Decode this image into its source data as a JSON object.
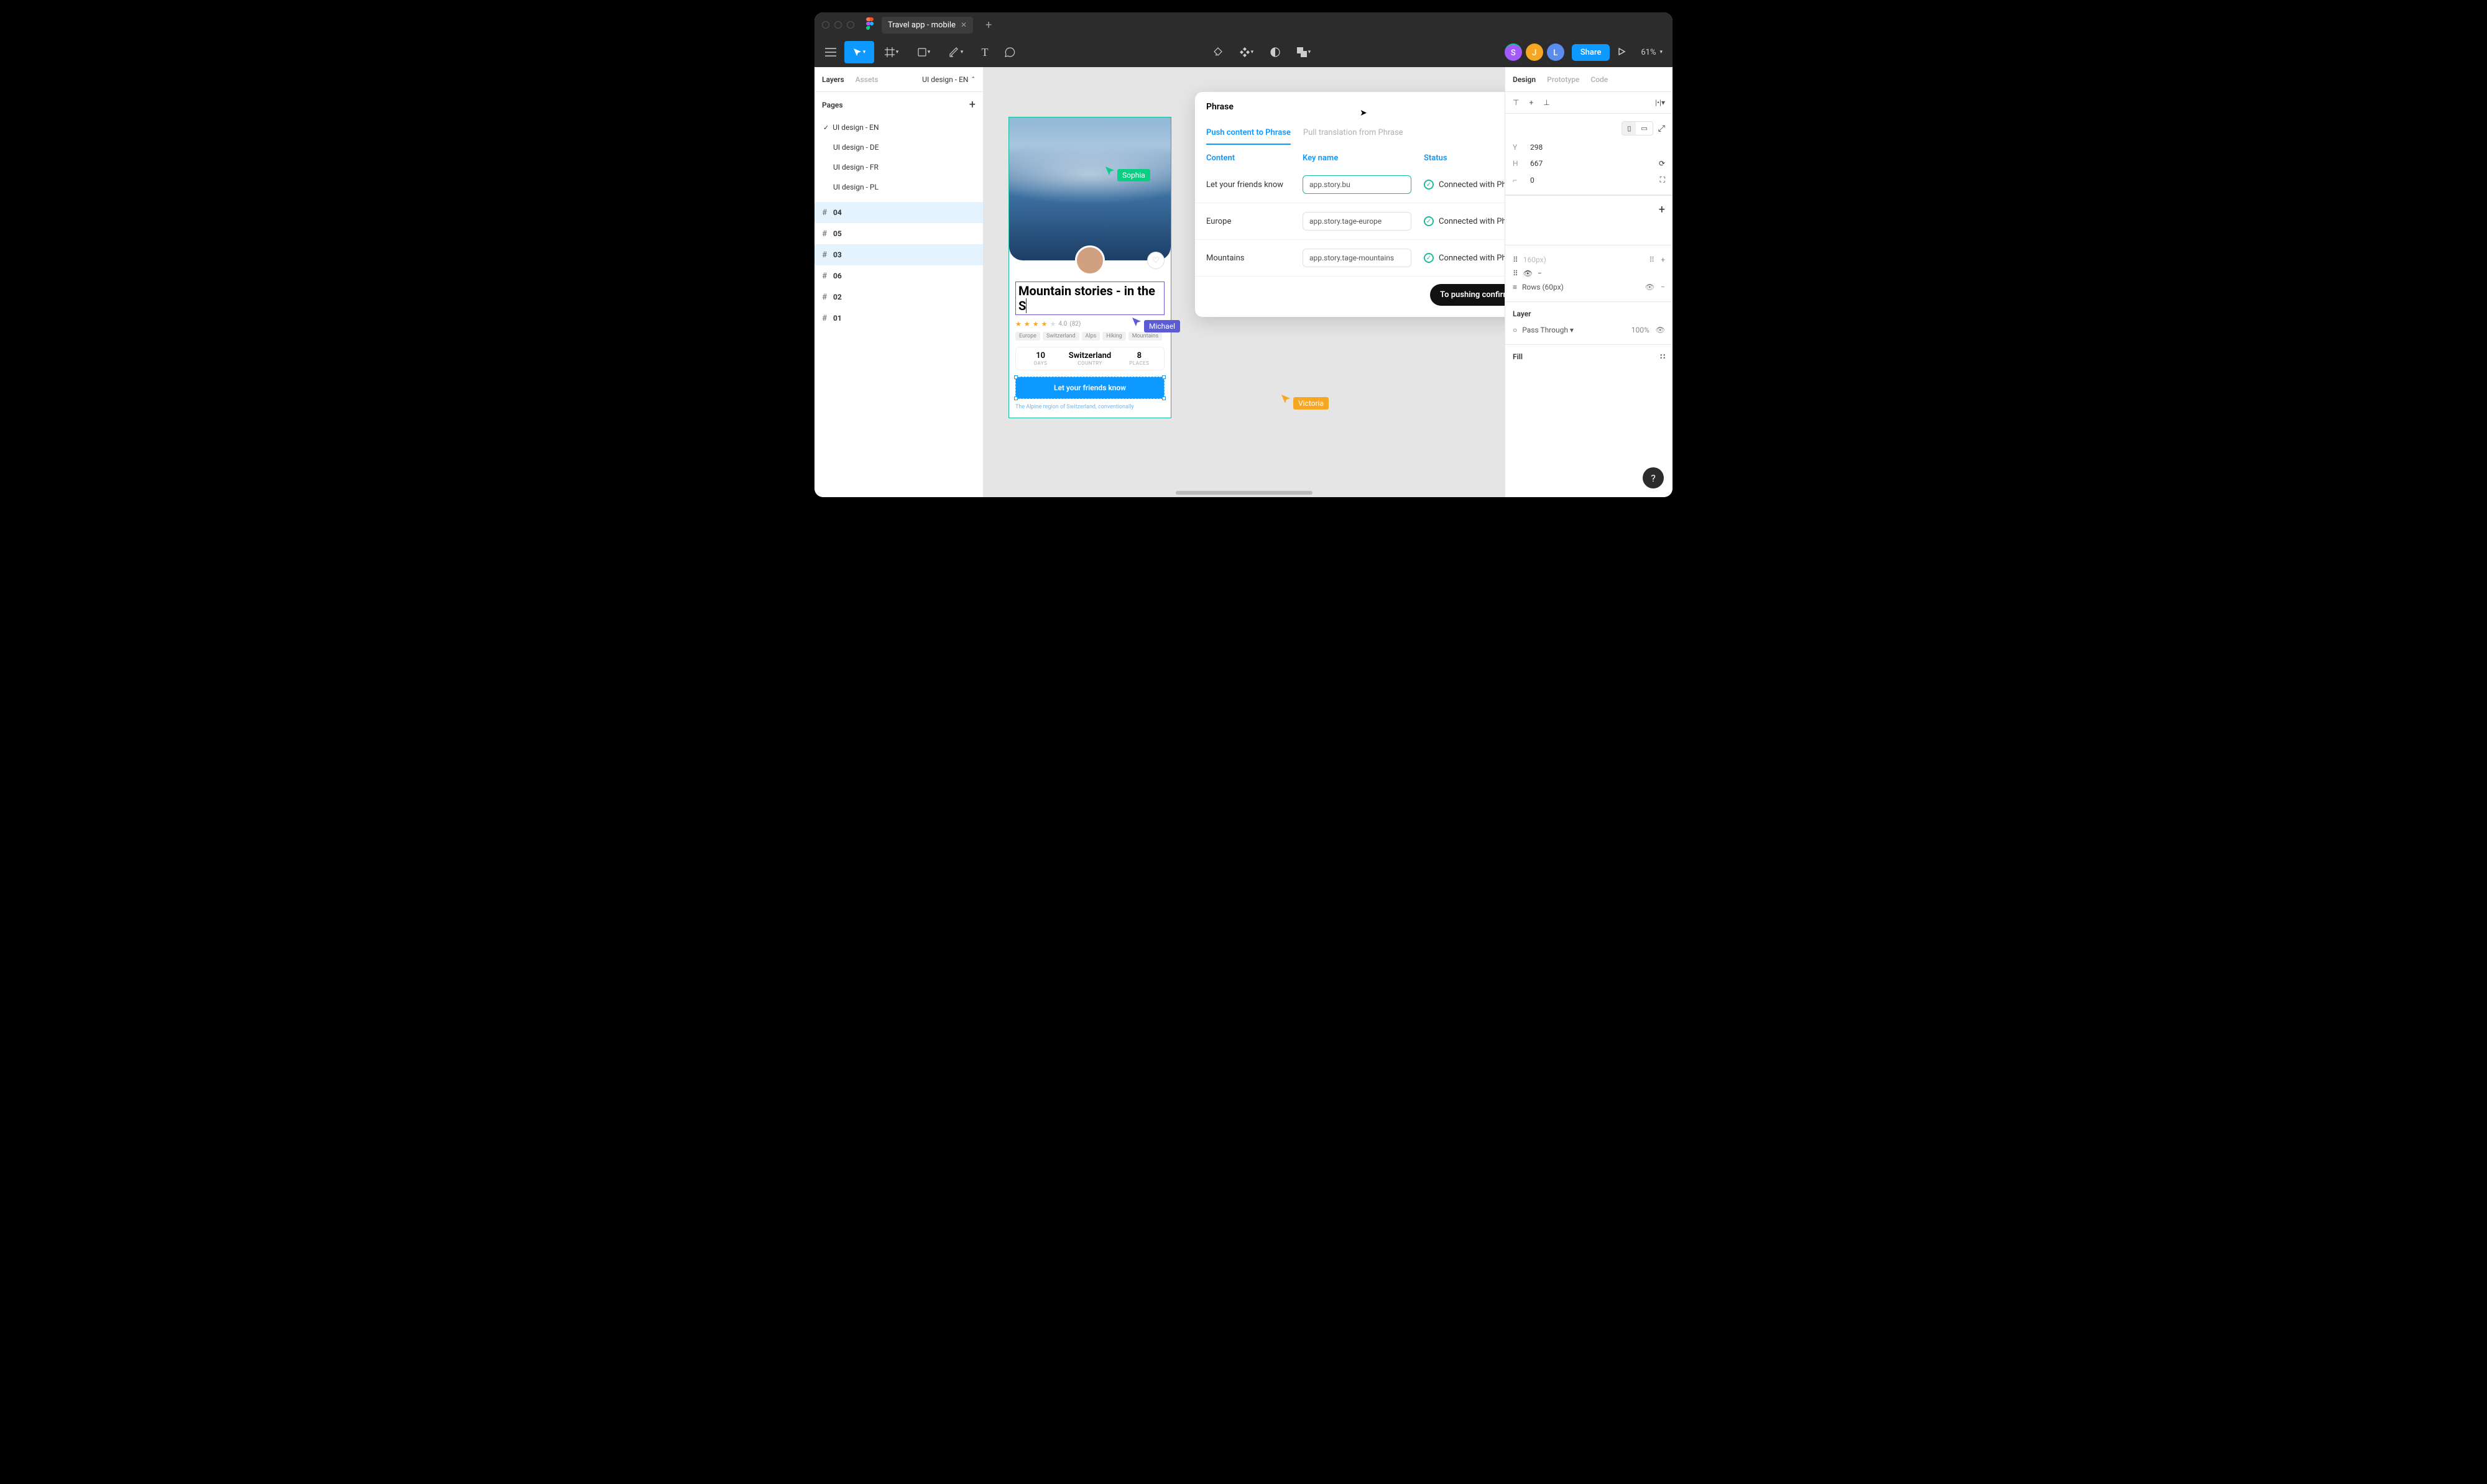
{
  "titlebar": {
    "tab": "Travel app - mobile"
  },
  "toolbar": {
    "avatars": [
      {
        "initial": "S",
        "color": "#a259ff"
      },
      {
        "initial": "J",
        "color": "#f5a623"
      },
      {
        "initial": "L",
        "color": "#5b8def"
      }
    ],
    "share": "Share",
    "zoom": "61%"
  },
  "leftpanel": {
    "tabs": {
      "layers": "Layers",
      "assets": "Assets"
    },
    "dropdown": "UI design - EN",
    "pages_label": "Pages",
    "pages": [
      {
        "name": "UI design - EN",
        "selected": true
      },
      {
        "name": "UI design - DE"
      },
      {
        "name": "UI design - FR"
      },
      {
        "name": "UI design - PL"
      }
    ],
    "frames": [
      {
        "name": "04",
        "hl": true
      },
      {
        "name": "05"
      },
      {
        "name": "03",
        "hl": true
      },
      {
        "name": "06"
      },
      {
        "name": "02"
      },
      {
        "name": "01"
      }
    ]
  },
  "canvas": {
    "artboard": {
      "title": "Mountain stories - in the S",
      "rating_value": "4.0",
      "rating_count": "(82)",
      "tags": [
        "Europe",
        "Switzerland",
        "Alps",
        "Hiking",
        "Mountains"
      ],
      "stats": [
        {
          "n": "10",
          "l": "DAYS"
        },
        {
          "n": "Switzerland",
          "l": "COUNTRY"
        },
        {
          "n": "8",
          "l": "PLACES"
        }
      ],
      "button": "Let your friends know",
      "desc": "The Alpine region of Switzerland, conventionally"
    },
    "cursors": {
      "sophia": "Sophia",
      "michael": "Michael",
      "victoria": "Victoria"
    }
  },
  "plugin": {
    "title": "Phrase",
    "tabs": {
      "push": "Push content to Phrase",
      "pull": "Pull translation from Phrase"
    },
    "cols": {
      "content": "Content",
      "key": "Key name",
      "status": "Status"
    },
    "rows": [
      {
        "content": "Let your friends know",
        "key": "app.story.bu",
        "status": "Connected with Phrase",
        "active": true
      },
      {
        "content": "Europe",
        "key": "app.story.tage-europe",
        "status": "Connected with Phrase"
      },
      {
        "content": "Mountains",
        "key": "app.story.tage-mountains",
        "status": "Connected with Phrase"
      }
    ],
    "confirm": "To pushing confirmation"
  },
  "rightpanel": {
    "tabs": {
      "design": "Design",
      "prototype": "Prototype",
      "code": "Code"
    },
    "y": "298",
    "h": "667",
    "r": "0",
    "grid_cols": "160px)",
    "grid_rows": "Rows (60px)",
    "layer_label": "Layer",
    "layer_mode": "Pass Through",
    "layer_opacity": "100%",
    "fill_label": "Fill"
  }
}
